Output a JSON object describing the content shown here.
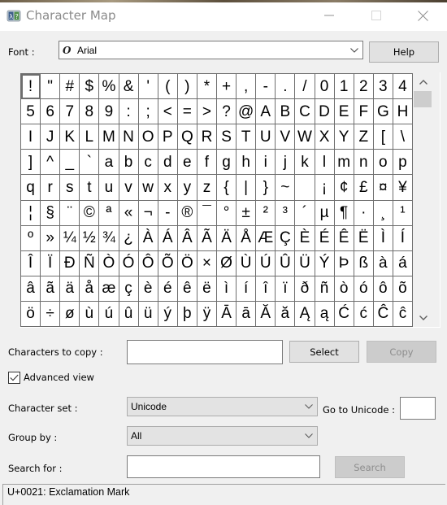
{
  "window": {
    "title": "Character Map",
    "icon": "charmap-app-icon",
    "controls": [
      "minimize-icon",
      "maximize-icon",
      "close-icon"
    ]
  },
  "font": {
    "label": "Font :",
    "value": "Arial",
    "font_type_icon": "opentype-font-icon",
    "help_label": "Help"
  },
  "grid": {
    "selected_index": 0,
    "characters": [
      "!",
      "\"",
      "#",
      "$",
      "%",
      "&",
      "'",
      "(",
      ")",
      "*",
      "+",
      ",",
      "-",
      ".",
      "/",
      "0",
      "1",
      "2",
      "3",
      "4",
      "5",
      "6",
      "7",
      "8",
      "9",
      ":",
      ";",
      "<",
      "=",
      ">",
      "?",
      "@",
      "A",
      "B",
      "C",
      "D",
      "E",
      "F",
      "G",
      "H",
      "I",
      "J",
      "K",
      "L",
      "M",
      "N",
      "O",
      "P",
      "Q",
      "R",
      "S",
      "T",
      "U",
      "V",
      "W",
      "X",
      "Y",
      "Z",
      "[",
      "\\",
      "]",
      "^",
      "_",
      "`",
      "a",
      "b",
      "c",
      "d",
      "e",
      "f",
      "g",
      "h",
      "i",
      "j",
      "k",
      "l",
      "m",
      "n",
      "o",
      "p",
      "q",
      "r",
      "s",
      "t",
      "u",
      "v",
      "w",
      "x",
      "y",
      "z",
      "{",
      "|",
      "}",
      "~",
      " ",
      "¡",
      "¢",
      "£",
      "¤",
      "¥",
      "¦",
      "§",
      "¨",
      "©",
      "ª",
      "«",
      "¬",
      "-",
      "®",
      "¯",
      "°",
      "±",
      "²",
      "³",
      "´",
      "µ",
      "¶",
      "·",
      "¸",
      "¹",
      "º",
      "»",
      "¼",
      "½",
      "¾",
      "¿",
      "À",
      "Á",
      "Â",
      "Ã",
      "Ä",
      "Å",
      "Æ",
      "Ç",
      "È",
      "É",
      "Ê",
      "Ë",
      "Ì",
      "Í",
      "Î",
      "Ï",
      "Ð",
      "Ñ",
      "Ò",
      "Ó",
      "Ô",
      "Õ",
      "Ö",
      "×",
      "Ø",
      "Ù",
      "Ú",
      "Û",
      "Ü",
      "Ý",
      "Þ",
      "ß",
      "à",
      "á",
      "â",
      "ã",
      "ä",
      "å",
      "æ",
      "ç",
      "è",
      "é",
      "ê",
      "ë",
      "ì",
      "í",
      "î",
      "ï",
      "ð",
      "ñ",
      "ò",
      "ó",
      "ô",
      "õ",
      "ö",
      "÷",
      "ø",
      "ù",
      "ú",
      "û",
      "ü",
      "ý",
      "þ",
      "ÿ",
      "Ā",
      "ā",
      "Ă",
      "ă",
      "Ą",
      "ą",
      "Ć",
      "ć",
      "Ĉ",
      "ĉ"
    ]
  },
  "copy": {
    "label": "Characters to copy :",
    "value": "",
    "select_label": "Select",
    "copy_label": "Copy"
  },
  "advanced_view": {
    "label": "Advanced view",
    "checked": true
  },
  "character_set": {
    "label": "Character set :",
    "value": "Unicode"
  },
  "goto_unicode": {
    "label": "Go to Unicode :",
    "value": ""
  },
  "group_by": {
    "label": "Group by :",
    "value": "All"
  },
  "search": {
    "label": "Search for :",
    "value": "",
    "button_label": "Search"
  },
  "status": {
    "text": "U+0021: Exclamation Mark"
  }
}
